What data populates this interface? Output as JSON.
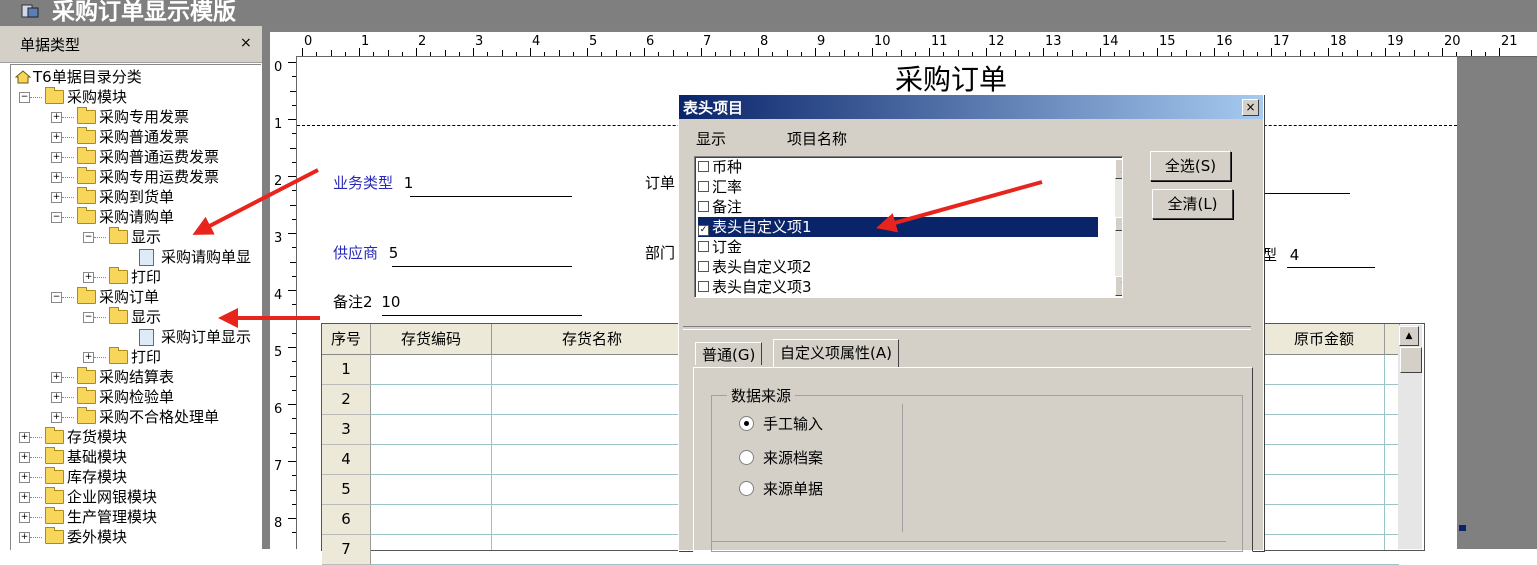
{
  "window": {
    "title": "采购订单显示模版"
  },
  "left_panel": {
    "title": "单据类型",
    "close": "×",
    "tree": [
      {
        "label": "T6单据目录分类",
        "level": 0,
        "icon": "home-icon"
      },
      {
        "label": "采购模块",
        "level": 1,
        "expanded": true
      },
      {
        "label": "采购专用发票",
        "level": 2
      },
      {
        "label": "采购普通发票",
        "level": 2
      },
      {
        "label": "采购普通运费发票",
        "level": 2
      },
      {
        "label": "采购专用运费发票",
        "level": 2
      },
      {
        "label": "采购到货单",
        "level": 2
      },
      {
        "label": "采购请购单",
        "level": 2,
        "expanded": true
      },
      {
        "label": "显示",
        "level": 3,
        "expanded": true
      },
      {
        "label": "采购请购单显",
        "level": 4
      },
      {
        "label": "打印",
        "level": 3
      },
      {
        "label": "采购订单",
        "level": 2,
        "expanded": true
      },
      {
        "label": "显示",
        "level": 3,
        "expanded": true
      },
      {
        "label": "采购订单显示",
        "level": 4
      },
      {
        "label": "打印",
        "level": 3
      },
      {
        "label": "采购结算表",
        "level": 2
      },
      {
        "label": "采购检验单",
        "level": 2
      },
      {
        "label": "采购不合格处理单",
        "level": 2
      },
      {
        "label": "存货模块",
        "level": 1
      },
      {
        "label": "基础模块",
        "level": 1
      },
      {
        "label": "库存模块",
        "level": 1
      },
      {
        "label": "企业网银模块",
        "level": 1
      },
      {
        "label": "生产管理模块",
        "level": 1
      },
      {
        "label": "委外模块",
        "level": 1
      }
    ]
  },
  "ruler": {
    "h_numbers": [
      "0",
      "1",
      "2",
      "3",
      "4",
      "5",
      "6",
      "7",
      "8",
      "9",
      "10",
      "11",
      "12",
      "13",
      "14",
      "15",
      "16",
      "17",
      "18",
      "19",
      "20",
      "21"
    ],
    "v_numbers": [
      "0",
      "1",
      "2",
      "3",
      "4",
      "5",
      "6",
      "7",
      "8"
    ]
  },
  "document": {
    "title": "采购订单",
    "fields": {
      "business_type_label": "业务类型",
      "business_type_value": "1",
      "order_label": "订单",
      "supplier_label": "供应商",
      "supplier_value": "5",
      "department_label": "部门",
      "type_label": "型",
      "type_value": "4",
      "note2_label": "备注2",
      "note2_value": "10"
    },
    "grid": {
      "headers": [
        "序号",
        "存货编码",
        "存货名称",
        "原币金额"
      ],
      "rows": [
        "1",
        "2",
        "3",
        "4",
        "5",
        "6",
        "7"
      ]
    }
  },
  "dialog": {
    "title": "表头项目",
    "close": "×",
    "col_show": "显示",
    "col_name": "项目名称",
    "items": [
      {
        "label": "币种",
        "checked": false,
        "selected": false
      },
      {
        "label": "汇率",
        "checked": false,
        "selected": false
      },
      {
        "label": "备注",
        "checked": false,
        "selected": false
      },
      {
        "label": "表头自定义项1",
        "checked": true,
        "selected": true
      },
      {
        "label": "订金",
        "checked": false,
        "selected": false
      },
      {
        "label": "表头自定义项2",
        "checked": false,
        "selected": false
      },
      {
        "label": "表头自定义项3",
        "checked": false,
        "selected": false
      }
    ],
    "select_all": "全选(S)",
    "clear_all": "全清(L)",
    "tabs": [
      "普通(G)",
      "自定义项属性(A)"
    ],
    "active_tab": "自定义项属性(A)",
    "group_title": "数据来源",
    "options": [
      {
        "label": "手工输入",
        "selected": true
      },
      {
        "label": "来源档案",
        "selected": false
      },
      {
        "label": "来源单据",
        "selected": false
      }
    ]
  },
  "colors": {
    "arrow": "#e8251d",
    "title_bar": "#7f7f7f",
    "dialog_title_start": "#0a246a",
    "selection": "#0a246a",
    "field_label": "#2a2ab8"
  }
}
